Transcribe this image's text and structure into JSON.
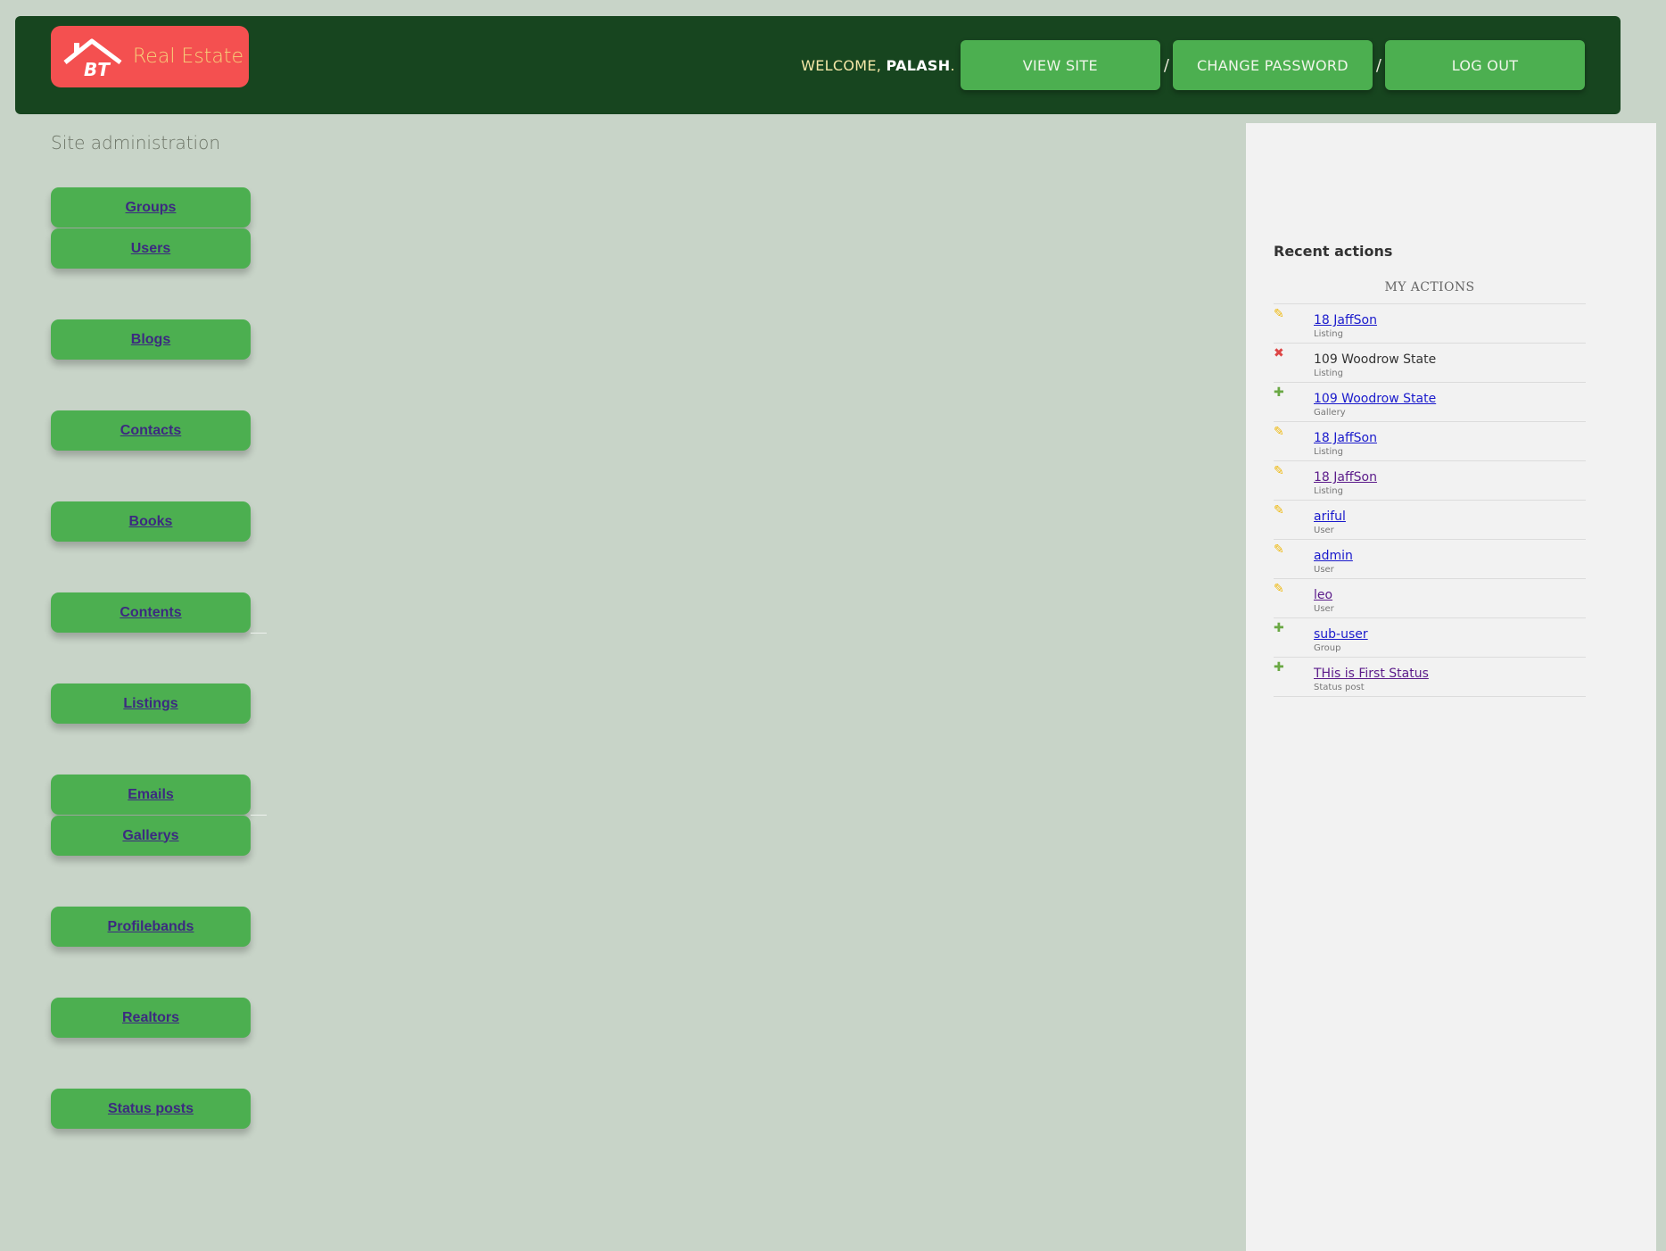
{
  "branding": {
    "logo_text": "BT",
    "name": "Real Estate"
  },
  "header": {
    "welcome_prefix": "WELCOME, ",
    "user": "PALASH",
    "welcome_suffix": ".",
    "view_site": "VIEW SITE",
    "change_password": "CHANGE PASSWORD",
    "log_out": "LOG OUT",
    "separator": "/"
  },
  "main": {
    "title": "Site administration",
    "models": [
      "Groups",
      "Users",
      "Blogs",
      "Contacts",
      "Books",
      "Contents",
      "Listings",
      "Emails",
      "Gallerys",
      "Profilebands",
      "Realtors",
      "Status posts"
    ]
  },
  "sidebar": {
    "recent_title": "Recent actions",
    "my_actions": "MY ACTIONS",
    "actions": [
      {
        "icon": "change-icon",
        "title": "18 JaffSon",
        "type": "Listing",
        "link": true
      },
      {
        "icon": "delete-icon",
        "title": "109 Woodrow State",
        "type": "Listing",
        "link": false
      },
      {
        "icon": "add-icon",
        "title": "109 Woodrow State",
        "type": "Gallery",
        "link": true
      },
      {
        "icon": "change-icon",
        "title": "18 JaffSon",
        "type": "Listing",
        "link": true
      },
      {
        "icon": "change-icon",
        "title": "18 JaffSon",
        "type": "Listing",
        "link": true
      },
      {
        "icon": "change-icon",
        "title": "ariful",
        "type": "User",
        "link": true
      },
      {
        "icon": "change-icon",
        "title": "admin",
        "type": "User",
        "link": true
      },
      {
        "icon": "change-icon",
        "title": "leo",
        "type": "User",
        "link": true
      },
      {
        "icon": "add-icon",
        "title": "sub-user",
        "type": "Group",
        "link": true
      },
      {
        "icon": "add-icon",
        "title": "THis is First Status",
        "type": "Status post",
        "link": true
      }
    ]
  },
  "colors": {
    "header_bg": "#17451f",
    "page_bg": "#c8d4c8",
    "button_green": "#4caf50",
    "brand_red": "#f45050"
  }
}
